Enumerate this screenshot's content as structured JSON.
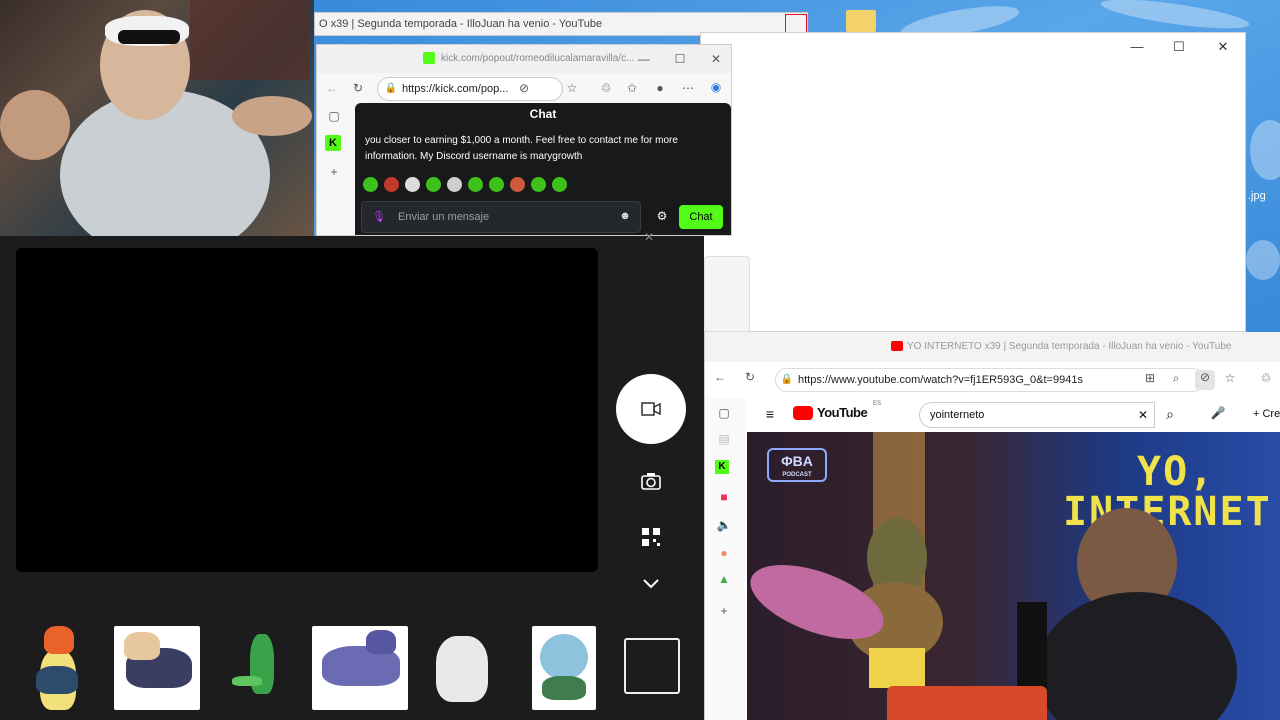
{
  "bg_youtube_tab": {
    "title": "O x39 | Segunda temporada - IlloJuan ha venio - YouTube"
  },
  "desktop": {
    "file_label": ".jpg"
  },
  "white_window": {
    "minimize": "—",
    "maximize": "☐",
    "close": "✕"
  },
  "kick_browser": {
    "tab_title": "kick.com/popout/romeodilucalamaravilla/c...",
    "url": "https://kick.com/pop...",
    "chat": {
      "header": "Chat",
      "message": "you closer to earning $1,000 a month. Feel free to contact me for more information. My Discord username is marygrowth",
      "input_placeholder": "Enviar un mensaje",
      "send_label": "Chat"
    }
  },
  "camera_app": {
    "tools": [
      "camera-icon",
      "qr-icon",
      "chevron-down-icon"
    ]
  },
  "youtube_browser": {
    "tab_title": "YO INTERNETO x39 | Segunda temporada - IlloJuan ha venio - YouTube",
    "url": "https://www.youtube.com/watch?v=fj1ER593G_0&t=9941s",
    "logo_text": "YouTube",
    "logo_sup": "ES",
    "search_value": "yointerneto",
    "create_label": "+ Cre",
    "video": {
      "badge": "ΦBA",
      "badge_sub": "PODCAST",
      "overlay_line1": "YO,",
      "overlay_line2": "INTERNET"
    }
  },
  "colors": {
    "kick_green": "#53fc18",
    "youtube_red": "#ff0000",
    "chat_bg": "#18191b"
  }
}
